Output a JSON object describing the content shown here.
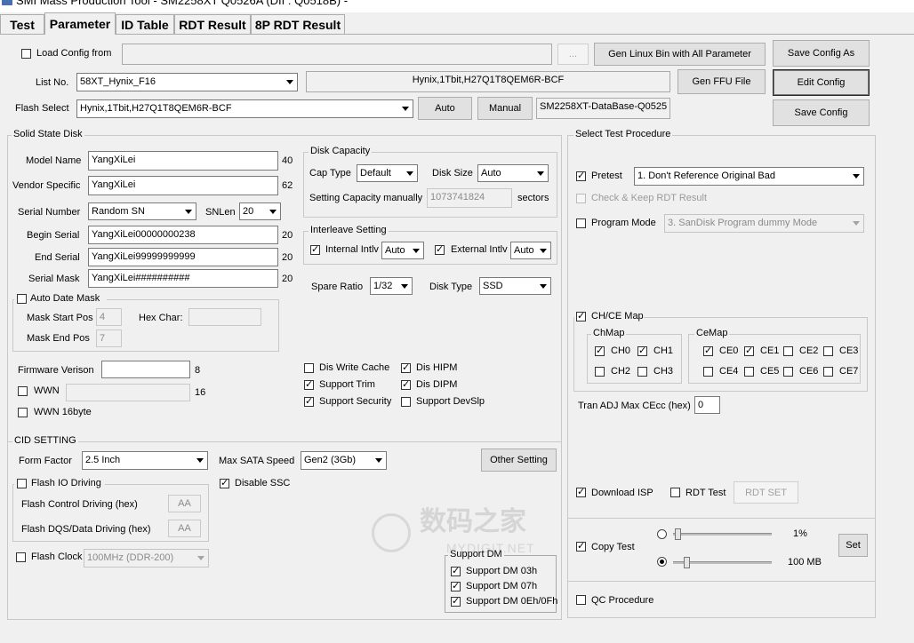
{
  "window": {
    "title": "SMI Mass Production Tool       - SM2258XT     Q0526A     (DII : Q0518B) -"
  },
  "tabs": [
    "Test",
    "Parameter",
    "ID Table",
    "RDT Result",
    "8P RDT Result"
  ],
  "top": {
    "load_config_label": "Load Config from",
    "load_config_value": "",
    "browse_label": "...",
    "gen_linux_bin_label": "Gen Linux Bin with All Parameter",
    "save_config_as_label": "Save Config As",
    "list_no_label": "List No.",
    "list_no_value": "58XT_Hynix_F16",
    "list_no_desc": "Hynix,1Tbit,H27Q1T8QEM6R-BCF",
    "gen_ffu_label": "Gen FFU File",
    "edit_config_label": "Edit Config",
    "flash_select_label": "Flash Select",
    "flash_select_value": "Hynix,1Tbit,H27Q1T8QEM6R-BCF",
    "auto_label": "Auto",
    "manual_label": "Manual",
    "database_value": "SM2258XT-DataBase-Q0525",
    "save_config_label": "Save Config"
  },
  "ssd": {
    "title": "Solid State Disk",
    "model_name_label": "Model Name",
    "model_name_value": "YangXiLei",
    "model_name_max": "40",
    "vendor_label": "Vendor Specific",
    "vendor_value": "YangXiLei",
    "vendor_max": "62",
    "serial_number_label": "Serial Number",
    "serial_number_value": "Random SN",
    "snlen_label": "SNLen",
    "snlen_value": "20",
    "begin_serial_label": "Begin Serial",
    "begin_serial_value": "YangXiLei00000000238",
    "begin_serial_max": "20",
    "end_serial_label": "End Serial",
    "end_serial_value": "YangXiLei99999999999",
    "end_serial_max": "20",
    "serial_mask_label": "Serial Mask",
    "serial_mask_value": "YangXiLei##########",
    "serial_mask_max": "20",
    "auto_date_mask_label": "Auto Date Mask",
    "mask_start_pos_label": "Mask Start Pos",
    "mask_start_pos_value": "4",
    "hex_char_label": "Hex Char:",
    "hex_char_value": "",
    "mask_end_pos_label": "Mask End Pos",
    "mask_end_pos_value": "7",
    "firmware_version_label": "Firmware Verison",
    "firmware_version_value": "",
    "firmware_version_max": "8",
    "wwn_label": "WWN",
    "wwn_value": "",
    "wwn_max": "16",
    "wwn16_label": "WWN 16byte"
  },
  "disk_capacity": {
    "title": "Disk Capacity",
    "cap_type_label": "Cap Type",
    "cap_type_value": "Default",
    "disk_size_label": "Disk Size",
    "disk_size_value": "Auto",
    "setting_capacity_label": "Setting Capacity manually",
    "setting_capacity_value": "1073741824",
    "sectors_label": "sectors"
  },
  "interleave": {
    "title": "Interleave Setting",
    "internal_label": "Internal Intlv",
    "internal_value": "Auto",
    "external_label": "External Intlv",
    "external_value": "Auto"
  },
  "spare": {
    "spare_ratio_label": "Spare Ratio",
    "spare_ratio_value": "1/32",
    "disk_type_label": "Disk Type",
    "disk_type_value": "SSD"
  },
  "options": {
    "dis_write_cache": "Dis Write Cache",
    "dis_hipm": "Dis HIPM",
    "support_trim": "Support Trim",
    "dis_dipm": "Dis DIPM",
    "support_security": "Support Security",
    "support_devslp": "Support DevSlp"
  },
  "cid": {
    "title": "CID SETTING",
    "form_factor_label": "Form Factor",
    "form_factor_value": "2.5 Inch",
    "max_sata_label": "Max SATA Speed",
    "max_sata_value": "Gen2 (3Gb)",
    "other_setting_label": "Other Setting",
    "flash_io_driving_label": "Flash IO Driving",
    "disable_ssc_label": "Disable SSC",
    "flash_control_label": "Flash Control Driving (hex)",
    "flash_control_value": "AA",
    "flash_dqs_label": "Flash DQS/Data Driving (hex)",
    "flash_dqs_value": "AA",
    "flash_clock_label": "Flash Clock",
    "flash_clock_value": "100MHz (DDR-200)"
  },
  "support_dm": {
    "title": "Support DM",
    "dm03": "Support DM 03h",
    "dm07": "Support DM 07h",
    "dm0e": "Support DM 0Eh/0Fh"
  },
  "test_proc": {
    "title": "Select Test Procedure",
    "pretest_label": "Pretest",
    "pretest_value": "1. Don't Reference Original Bad",
    "check_keep_label": "Check & Keep RDT Result",
    "program_mode_label": "Program Mode",
    "program_mode_value": "3. SanDisk Program dummy Mode",
    "chce_map_label": "CH/CE Map",
    "chmap_title": "ChMap",
    "cemap_title": "CeMap",
    "ch": [
      "CH0",
      "CH1",
      "CH2",
      "CH3"
    ],
    "ce": [
      "CE0",
      "CE1",
      "CE2",
      "CE3",
      "CE4",
      "CE5",
      "CE6",
      "CE7"
    ],
    "tran_adj_label": "Tran ADJ Max CEcc (hex)",
    "tran_adj_value": "0",
    "download_isp_label": "Download ISP",
    "rdt_test_label": "RDT Test",
    "rdt_set_label": "RDT SET",
    "copy_test_label": "Copy Test",
    "percent_value": "1%",
    "mb_value": "100 MB",
    "percent_fraction": 0.02,
    "mb_fraction": 0.12,
    "set_label": "Set",
    "qc_label": "QC Procedure"
  },
  "watermark": {
    "text": "数码之家",
    "sub": "MYDIGIT.NET"
  }
}
